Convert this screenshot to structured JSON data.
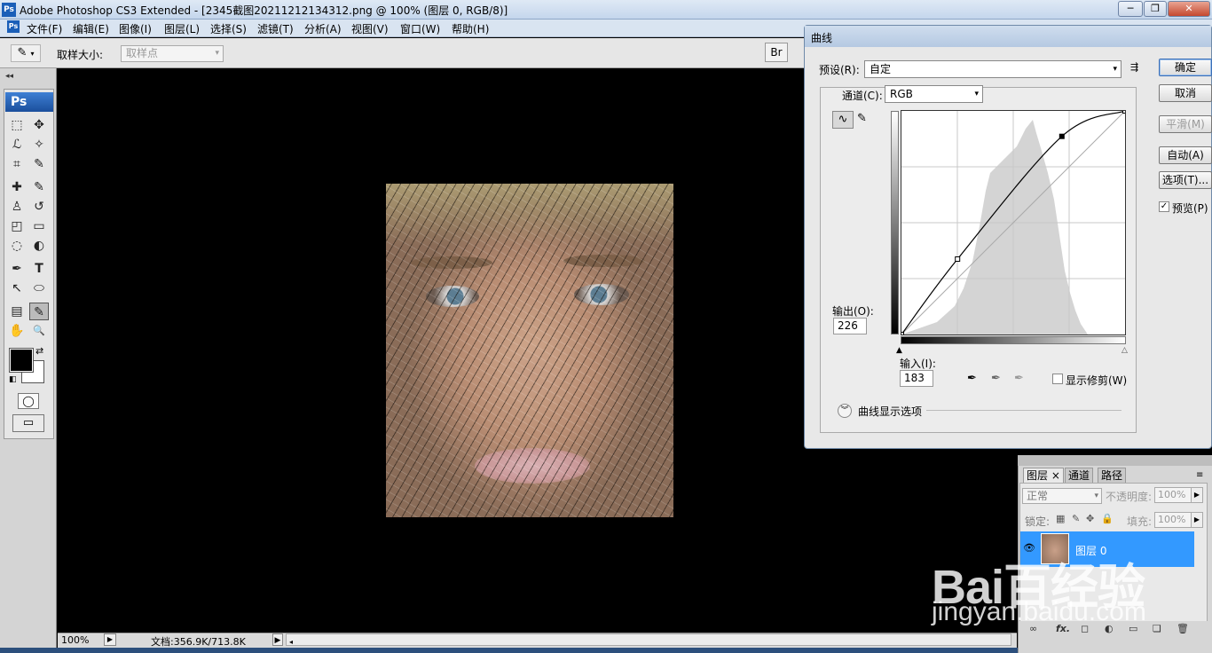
{
  "window": {
    "title": "Adobe Photoshop CS3 Extended - [2345截图20211212134312.png @ 100% (图层 0, RGB/8)]",
    "app_icon": "Ps",
    "controls": {
      "minimize": "─",
      "restore": "❐",
      "close": "✕"
    }
  },
  "menu": [
    "文件(F)",
    "编辑(E)",
    "图像(I)",
    "图层(L)",
    "选择(S)",
    "滤镜(T)",
    "分析(A)",
    "视图(V)",
    "窗口(W)",
    "帮助(H)"
  ],
  "options_bar": {
    "sample_size_label": "取样大小:",
    "sample_size_value": "取样点",
    "dropdown_arrow": "▾"
  },
  "toolbox": {
    "logo": "Ps",
    "collapse": "◂◂",
    "tool_icons": {
      "marquee": "⬚",
      "move": "✥",
      "lasso": "ℒ",
      "magic_wand": "✧",
      "crop": "⌗",
      "slice": "✎",
      "healing": "✚",
      "brush": "✎",
      "stamp": "♙",
      "history_brush": "↺",
      "eraser": "◰",
      "gradient": "▭",
      "blur": "◌",
      "dodge": "◐",
      "pen": "✒",
      "type": "T",
      "path_select": "↖",
      "shape": "⬭",
      "notes": "▤",
      "eyedropper": "✎",
      "hand": "✋",
      "zoom": "🔍"
    },
    "swap_icon": "⇄",
    "default_icon": "◧",
    "quickmask_icon": "◯",
    "screenmode_icon": "▭"
  },
  "status_bar": {
    "zoom": "100%",
    "doc_size": "文档:356.9K/713.8K",
    "arrow": "▶",
    "scroll_left": "◂"
  },
  "curves": {
    "title": "曲线",
    "preset_label": "预设(R):",
    "preset_value": "自定",
    "channel_label": "通道(C):",
    "channel_value": "RGB",
    "output_label": "输出(O):",
    "output_value": "226",
    "input_label": "输入(I):",
    "input_value": "183",
    "show_clipping_label": "显示修剪(W)",
    "display_options_label": "曲线显示选项",
    "buttons": {
      "ok": "确定",
      "cancel": "取消",
      "smooth": "平滑(M)",
      "auto": "自动(A)",
      "options": "选项(T)..."
    },
    "preview_label": "预览(P)",
    "preview_checked": true,
    "curve_points": [
      [
        0,
        0
      ],
      [
        64,
        86
      ],
      [
        183,
        226
      ],
      [
        255,
        255
      ]
    ],
    "icons": {
      "preset_menu": "⇶",
      "curve_mode": "∿",
      "pencil_mode": "✎",
      "black_picker": "✒",
      "gray_picker": "✒",
      "white_picker": "✒",
      "black_slider": "▲",
      "white_slider": "△",
      "expand": "︾",
      "check": "✓"
    }
  },
  "layers_panel": {
    "tabs": [
      "图层 ×",
      "通道",
      "路径"
    ],
    "blend_mode": "正常",
    "opacity_label": "不透明度:",
    "opacity_value": "100%",
    "lock_label": "锁定:",
    "fill_label": "填充:",
    "fill_value": "100%",
    "layer_name": "图层 0",
    "menu_icon": "≡",
    "eye_icon": "👁",
    "footer_icons": [
      "∞",
      "fx.",
      "◻",
      "◐",
      "▭",
      "❏",
      "🗑"
    ]
  },
  "watermark": {
    "brand": "Bai百经验",
    "url": "jingyan.baidu.com"
  }
}
